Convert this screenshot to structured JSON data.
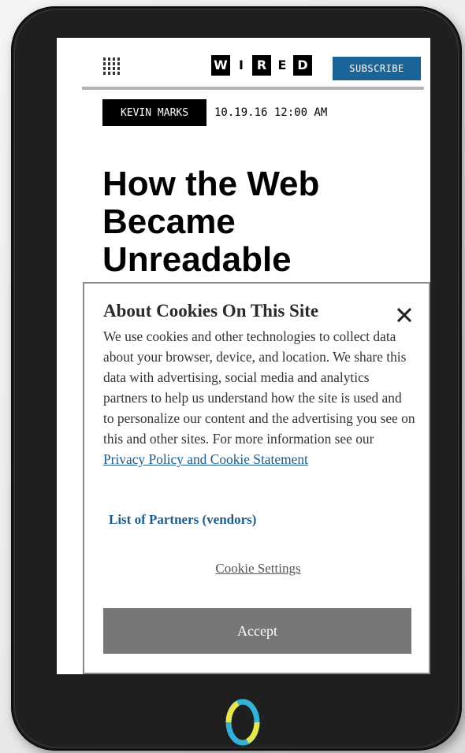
{
  "header": {
    "logo_letters": [
      "W",
      "I",
      "R",
      "E",
      "D"
    ],
    "subscribe_label": "SUBSCRIBE",
    "menu_icon": "grid-menu-icon"
  },
  "article": {
    "author": "KEVIN MARKS",
    "date": "10.19.16 12:00 AM",
    "headline_lines": [
      "How the Web",
      "Became",
      "Unreadable"
    ]
  },
  "cookie_banner": {
    "title": "About Cookies On This Site",
    "close_icon": "close-icon",
    "body": "We use cookies and other technologies to collect data about your browser, device, and location. We share this data with advertising, social media and analytics partners to help us understand how the site is used and to personalize our content and the advertising you see on this and other sites. For more information see our ",
    "privacy_link": "Privacy Policy and Cookie Statement",
    "partners_link": "List of Partners (vendors)",
    "settings_link": "Cookie Settings",
    "accept_label": "Accept"
  },
  "colors": {
    "subscribe_bg": "#1a6497",
    "link": "#1a5c8c",
    "accept_bg": "#777777",
    "device_body": "#1f1f1f",
    "home_ring": "#35b0d9"
  }
}
